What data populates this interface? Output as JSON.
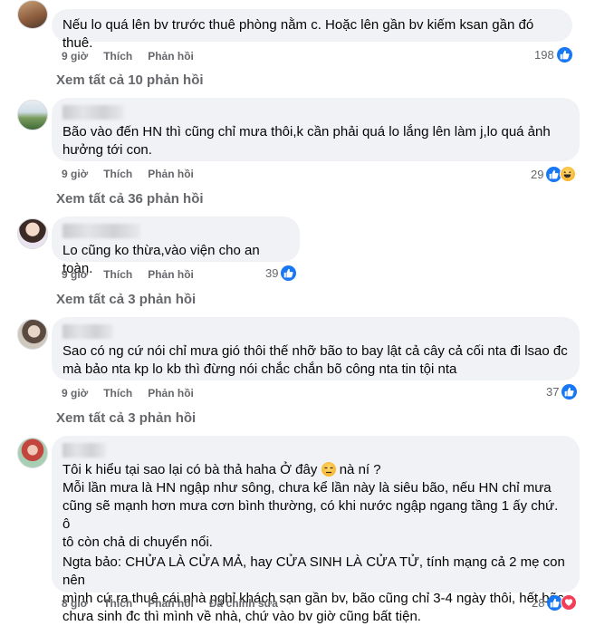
{
  "comments": [
    {
      "text_lines": [
        "Nếu lo quá lên bv trước thuê phòng nằm c. Hoặc lên gần bv kiếm ksan gần đó thuê."
      ],
      "time": "9 giờ",
      "like": "Thích",
      "reply": "Phản hồi",
      "reaction_count": "198",
      "reactions": [
        "like-icon"
      ],
      "view_replies": "Xem tất cả 10 phản hồi"
    },
    {
      "text_lines": [
        "Bão vào đến HN thì cũng chỉ mưa thôi,k cần phải quá lo lắng lên làm j,lo quá ảnh",
        "hưởng tới con."
      ],
      "time": "9 giờ",
      "like": "Thích",
      "reply": "Phản hồi",
      "reaction_count": "29",
      "reactions": [
        "like-icon",
        "haha-icon"
      ],
      "view_replies": "Xem tất cả 36 phản hồi"
    },
    {
      "text_lines": [
        "Lo cũng ko thừa,vào viện cho an toàn."
      ],
      "time": "9 giờ",
      "like": "Thích",
      "reply": "Phản hồi",
      "reaction_count": "39",
      "reactions": [
        "like-icon"
      ],
      "view_replies": "Xem tất cả 3 phản hồi"
    },
    {
      "text_lines": [
        "Sao có ng cứ nói chỉ mưa gió thôi thế nhỡ bão to bay lật cả cây cả cối nta đi lsao đc",
        "mà bảo nta kp lo kb thì đừng nói chắc chắn bõ công nta tin tội nta"
      ],
      "time": "9 giờ",
      "like": "Thích",
      "reply": "Phản hồi",
      "reaction_count": "37",
      "reactions": [
        "like-icon"
      ],
      "view_replies": "Xem tất cả 3 phản hồi"
    },
    {
      "para1_a": "Tôi k hiểu tại sao lại có bà thả haha Ở đây",
      "para1_b": " nà ní ?",
      "para2_lines": [
        "Mỗi lần mưa là HN ngập như sông, chưa kể lần này là siêu bão, nếu HN chỉ mưa",
        "cũng sẽ mạnh hơn mưa cơn bình thường, có khi nước ngập ngang tầng 1 ấy chứ. ô",
        "tô còn chả di chuyển nổi."
      ],
      "para3_lines": [
        "Ngta bảo: CHỬA LÀ CỬA MẢ, hay CỬA SINH LÀ CỬA TỬ, tính mạng cả 2 mẹ con nên",
        "mình cứ ra thuê cái nhà nghỉ khách sạn gần bv, bão cũng chỉ 3-4 ngày thôi, hết bão",
        "chưa sinh đc thì mình về nhà, chứ vào bv giờ cũng bất tiện."
      ],
      "time": "8 giờ",
      "like": "Thích",
      "reply": "Phản hồi",
      "edited": "Đã chỉnh sửa",
      "reaction_count": "28",
      "reactions": [
        "like-icon",
        "love-icon"
      ]
    }
  ],
  "colors": {
    "like_blue": "#1877f2",
    "bubble_bg": "#f0f2f5",
    "meta_gray": "#65676b"
  }
}
